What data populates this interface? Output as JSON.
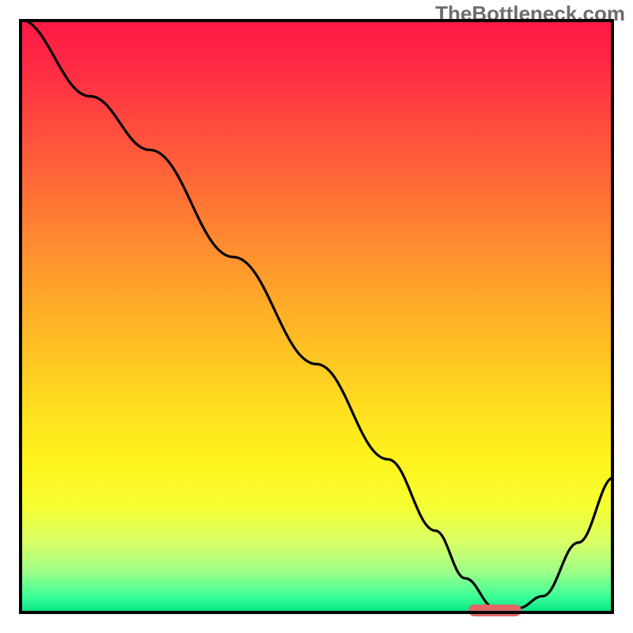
{
  "header": {
    "watermark": "TheBottleneck.com"
  },
  "chart_data": {
    "type": "line",
    "title": "",
    "xlabel": "",
    "ylabel": "",
    "xlim": [
      0,
      100
    ],
    "ylim": [
      0,
      100
    ],
    "grid": false,
    "legend": false,
    "series": [
      {
        "name": "bottleneck-curve",
        "x": [
          0,
          12,
          22,
          36,
          50,
          62,
          70,
          75,
          80,
          84,
          88,
          94,
          100
        ],
        "y": [
          100,
          87,
          78,
          60,
          42,
          26,
          14,
          6,
          1,
          1,
          3,
          12,
          23
        ]
      }
    ],
    "annotations": [
      {
        "name": "optimal-marker",
        "x": 80,
        "y": 0.6,
        "width_pct": 9,
        "height_pct": 2.1
      }
    ],
    "background_gradient": {
      "direction": "vertical",
      "stops": [
        {
          "pos": 0.0,
          "color": "#ff1846"
        },
        {
          "pos": 0.5,
          "color": "#ffc020"
        },
        {
          "pos": 0.8,
          "color": "#fff31c"
        },
        {
          "pos": 1.0,
          "color": "#00e083"
        }
      ]
    }
  }
}
